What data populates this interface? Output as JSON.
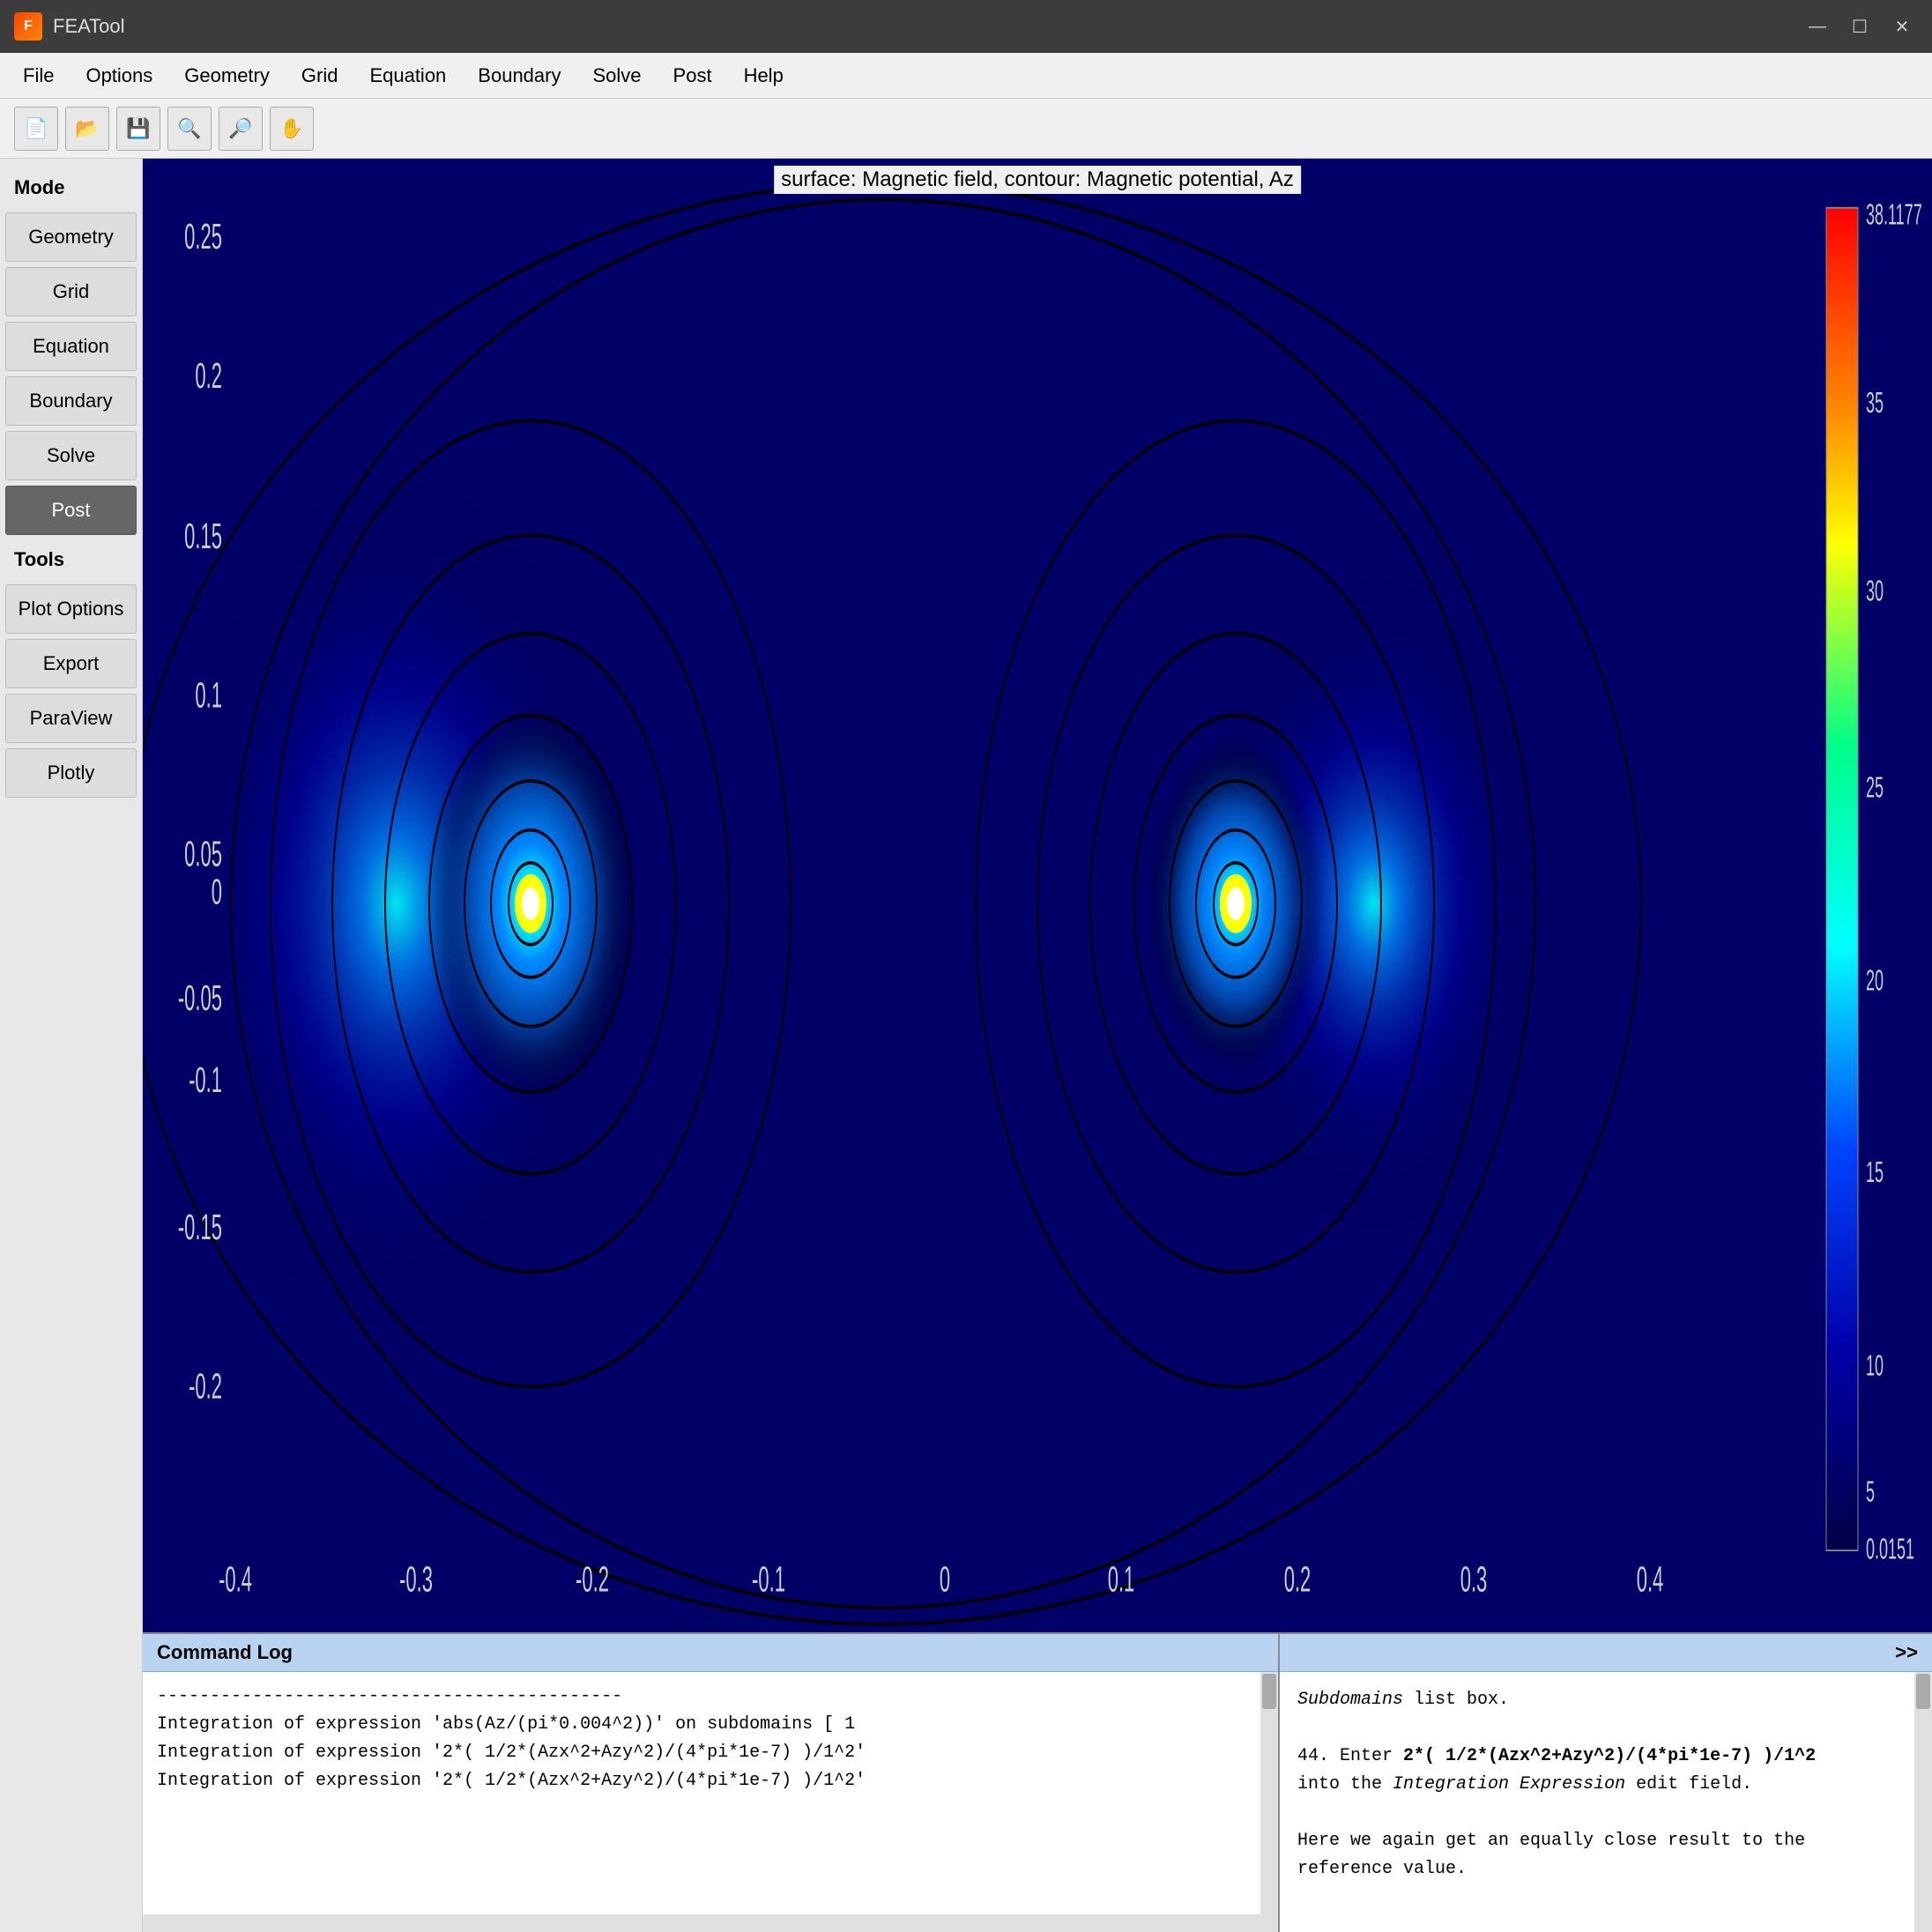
{
  "app": {
    "title": "FEATool",
    "icon": "F"
  },
  "window_controls": {
    "minimize": "—",
    "maximize": "☐",
    "close": "✕"
  },
  "menubar": {
    "items": [
      "File",
      "Options",
      "Geometry",
      "Grid",
      "Equation",
      "Boundary",
      "Solve",
      "Post",
      "Help"
    ]
  },
  "toolbar": {
    "buttons": [
      "📄",
      "📂",
      "💾",
      "🔍",
      "🔎",
      "✋"
    ]
  },
  "sidebar": {
    "mode_label": "Mode",
    "buttons": [
      "Geometry",
      "Grid",
      "Equation",
      "Boundary",
      "Solve"
    ],
    "active": "Post",
    "tools_label": "Tools",
    "tool_buttons": [
      "Plot Options",
      "Export",
      "ParaView",
      "Plotly"
    ]
  },
  "plot": {
    "title": "surface: Magnetic field, contour: Magnetic potential, Az",
    "x_axis": {
      "ticks": [
        "-0.4",
        "-0.3",
        "-0.2",
        "-0.1",
        "0",
        "0.1",
        "0.2",
        "0.3",
        "0.4"
      ]
    },
    "y_axis": {
      "ticks": [
        "0.25",
        "0.2",
        "0.15",
        "0.1",
        "0.05",
        "0",
        "-0.05",
        "-0.1",
        "-0.15",
        "-0.2"
      ]
    }
  },
  "colorbar": {
    "labels": [
      "35",
      "30",
      "25",
      "20",
      "15",
      "10",
      "5"
    ],
    "top_label": "38.1177",
    "bottom_label": "0.0151"
  },
  "bottom_panel": {
    "command_log": {
      "header": "Command Log",
      "lines": [
        "--------------------------------------------",
        "",
        "Integration of expression 'abs(Az/(pi*0.004^2))' on subdomains [ 1",
        "",
        "Integration of expression '2*( 1/2*(Azx^2+Azy^2)/(4*pi*1e-7) )/1^2'",
        "",
        "Integration of expression '2*( 1/2*(Azx^2+Azy^2)/(4*pi*1e-7) )/1^2'"
      ]
    },
    "right_panel": {
      "header": ">>",
      "lines": [
        "Subdomains list box.",
        "",
        "44. Enter 2*( 1/2*(Azx^2+Azy^2)/(4*pi*1e-7) )/1^2",
        "into the Integration Expression edit field.",
        "",
        "Here we again get an equally close result to the",
        "reference value."
      ]
    }
  }
}
